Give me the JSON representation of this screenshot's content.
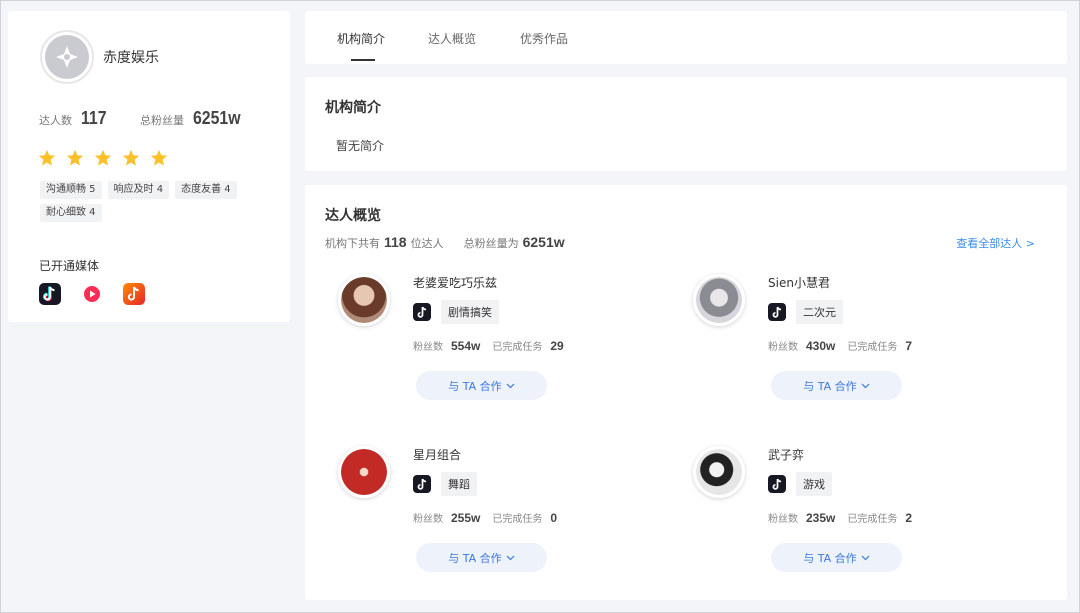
{
  "org": {
    "name": "赤度娱乐",
    "creators_label": "达人数",
    "creators_value": "117",
    "fans_label": "总粉丝量",
    "fans_value": "6251w",
    "rating_stars": 5,
    "star_color": "#fcc02d",
    "tags": [
      "沟通顺畅 5",
      "响应及时 4",
      "态度友善 4",
      "耐心细致 4"
    ],
    "media_title": "已开通媒体",
    "media": [
      "douyin-icon",
      "kuaishou-icon",
      "douyin-huoshan-icon"
    ]
  },
  "tabs": [
    {
      "label": "机构简介",
      "active": true
    },
    {
      "label": "达人概览",
      "active": false
    },
    {
      "label": "优秀作品",
      "active": false
    }
  ],
  "intro": {
    "title": "机构简介",
    "text": "暂无简介"
  },
  "overview": {
    "title": "达人概览",
    "summary_prefix": "机构下共有",
    "creator_count": "118",
    "summary_unit": "位达人",
    "fans_prefix": "总粉丝量为",
    "fans_total": "6251w",
    "view_all": "查看全部达人 >",
    "fans_label": "粉丝数",
    "tasks_label": "已完成任务",
    "button_label": "与 TA 合作",
    "creators": [
      {
        "name": "老婆爱吃巧乐兹",
        "category": "剧情搞笑",
        "fans": "554w",
        "tasks": "29"
      },
      {
        "name": "Sien小慧君",
        "category": "二次元",
        "fans": "430w",
        "tasks": "7"
      },
      {
        "name": "星月组合",
        "category": "舞蹈",
        "fans": "255w",
        "tasks": "0"
      },
      {
        "name": "武子弈",
        "category": "游戏",
        "fans": "235w",
        "tasks": "2"
      }
    ]
  },
  "colors": {
    "accent": "#3c8ce7",
    "button_bg": "#eef2fb",
    "page_bg": "#f4f5f9"
  }
}
